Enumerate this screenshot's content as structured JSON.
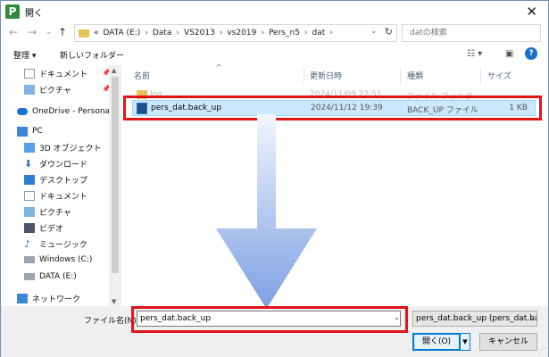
{
  "window": {
    "title": "開く",
    "app_icon_letter": "P"
  },
  "nav": {
    "back": "←",
    "forward": "→",
    "dropdown": "⌄",
    "up": "↑"
  },
  "address": {
    "crumbs": [
      "«",
      "DATA (E:)",
      "Data",
      "VS2013",
      "vs2019",
      "Pers_n5",
      "dat"
    ],
    "separator": "›"
  },
  "search": {
    "placeholder": "datの検索"
  },
  "toolbar": {
    "organize": "整理 ▾",
    "new_folder": "新しいフォルダー"
  },
  "sidebar": {
    "items": [
      {
        "label": "ドキュメント",
        "icon": "document-icon",
        "pinned": true
      },
      {
        "label": "ピクチャ",
        "icon": "pictures-icon",
        "pinned": true
      },
      {
        "label": "OneDrive - Personal",
        "icon": "cloud-icon"
      },
      {
        "label": "PC",
        "icon": "computer-icon"
      },
      {
        "label": "3D オブジェクト",
        "icon": "3d-objects-icon"
      },
      {
        "label": "ダウンロード",
        "icon": "download-icon"
      },
      {
        "label": "デスクトップ",
        "icon": "desktop-icon"
      },
      {
        "label": "ドキュメント",
        "icon": "document-icon"
      },
      {
        "label": "ピクチャ",
        "icon": "pictures-icon"
      },
      {
        "label": "ビデオ",
        "icon": "video-icon"
      },
      {
        "label": "ミュージック",
        "icon": "music-icon"
      },
      {
        "label": "Windows (C:)",
        "icon": "drive-icon"
      },
      {
        "label": "DATA (E:)",
        "icon": "drive-icon",
        "selected": true
      },
      {
        "label": "ネットワーク",
        "icon": "network-icon"
      }
    ]
  },
  "columns": {
    "name": "名前",
    "date": "更新日時",
    "type": "種類",
    "size": "サイズ"
  },
  "files": [
    {
      "name": "log",
      "date": "2024/11/09 22:51",
      "type": "ファイル フォルダー",
      "size": "",
      "icon": "folder-icon"
    },
    {
      "name": "pers_dat.back_up",
      "date": "2024/11/12 19:39",
      "type": "BACK_UP ファイル",
      "size": "1 KB",
      "icon": "file-icon",
      "selected": true
    }
  ],
  "footer": {
    "filename_label": "ファイル名(N):",
    "filename_value": "pers_dat.back_up",
    "filter_value": "pers_dat.back_up (pers_dat.bac",
    "open_label": "開く(O)",
    "cancel_label": "キャンセル"
  },
  "colors": {
    "accent": "#0078d7",
    "highlight": "#e2141a",
    "selection": "#cce8ff",
    "arrow": "#7d9fe3"
  }
}
